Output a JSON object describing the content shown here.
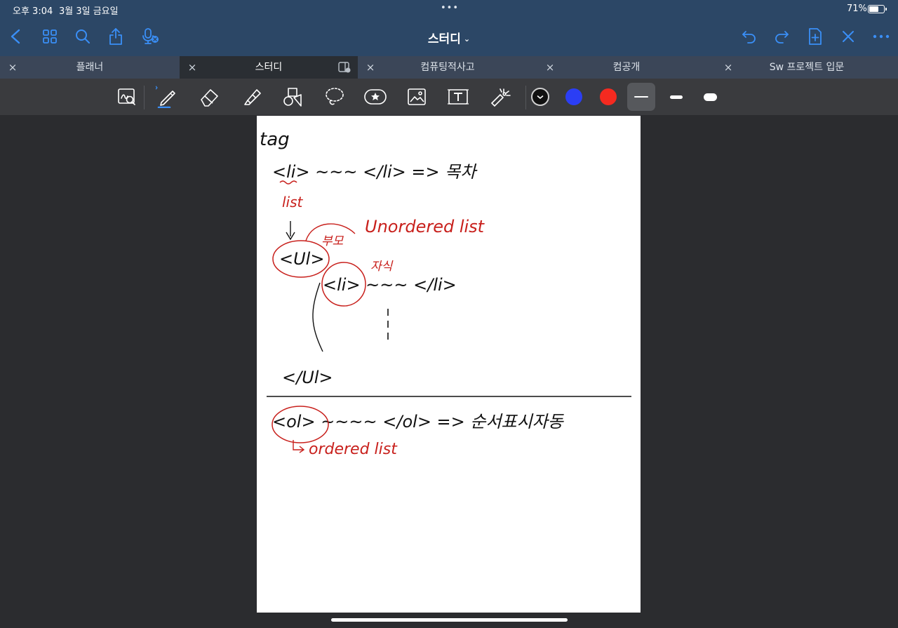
{
  "status_bar": {
    "time": "오후 3:04",
    "date": "3월 3일 금요일",
    "battery": "71%",
    "battery_level": 0.71,
    "more_dots": "•••"
  },
  "title_bar": {
    "title": "스터디",
    "title_chevron": "⌄",
    "left_icons": [
      "back-chevron-icon",
      "grid-thumbnails-icon",
      "search-icon",
      "share-icon",
      "microphone-icon"
    ],
    "right_icons": [
      "undo-icon",
      "redo-icon",
      "add-page-icon",
      "close-x-icon",
      "more-icon"
    ]
  },
  "tabs": [
    {
      "label": "플래너",
      "close": "×",
      "active": false
    },
    {
      "label": "스터디",
      "close": "×",
      "active": true
    },
    {
      "label": "컴퓨팅적사고",
      "close": "×",
      "active": false
    },
    {
      "label": "컴공개",
      "close": "×",
      "active": false
    },
    {
      "label": "Sw 프로젝트 입문",
      "close": "×",
      "active": false
    }
  ],
  "toolbar": {
    "tools": [
      "zoom-window-icon",
      "pen-icon",
      "eraser-icon",
      "highlighter-icon",
      "shapes-icon",
      "lasso-icon",
      "sticker-icon",
      "image-icon",
      "text-box-icon",
      "laser-pointer-icon"
    ],
    "selected_tool": "pen-icon",
    "colors": [
      "#111111",
      "#2b3ef5",
      "#f52a20"
    ],
    "selected_color": "#111111",
    "thickness_options": [
      "thin",
      "medium",
      "thick"
    ],
    "selected_thickness": "thin"
  },
  "note": {
    "lines": [
      "tag",
      "<li> ~~~ </li> => 목차",
      "list",
      "Unordered list",
      "부모",
      "<Ul>",
      "자식",
      "<li> ~~~ </li>",
      "</Ul>",
      "<ol> ~~~~ </ol> => 순서표시자동",
      "ordered list"
    ],
    "ink_colors": {
      "black": "#111111",
      "red": "#c8201c"
    }
  }
}
